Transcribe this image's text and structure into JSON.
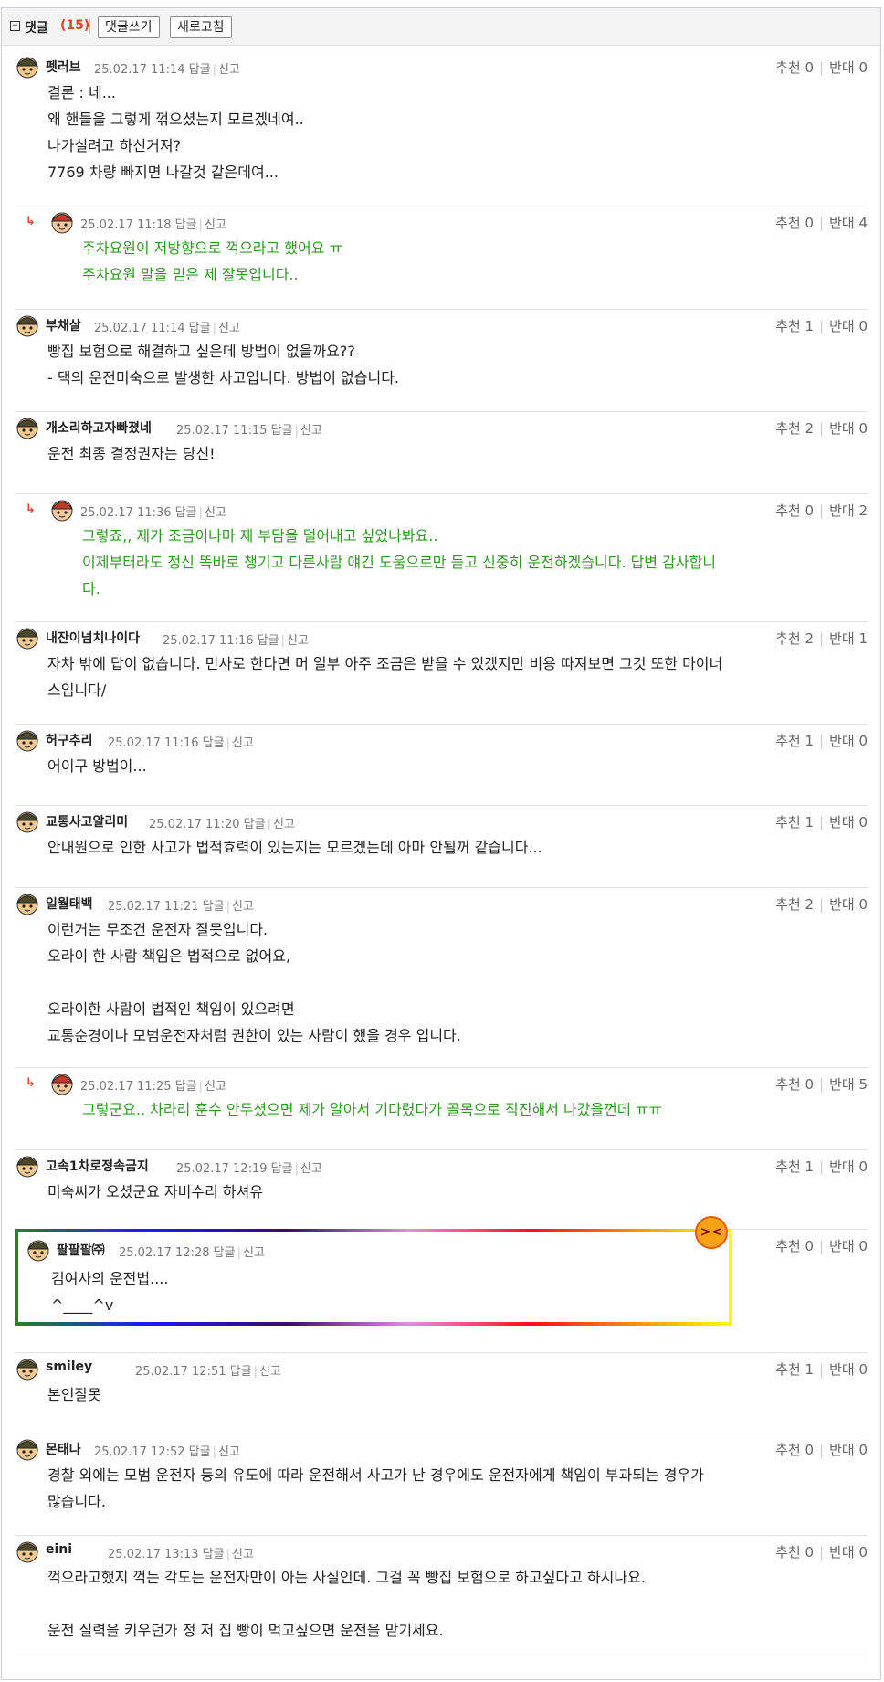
{
  "header": {
    "toggle_icon": "minus-box-icon",
    "title": "댓글",
    "count": "(15)",
    "write_button": "댓글쓰기",
    "refresh_button": "새로고침"
  },
  "labels": {
    "reply": "답글",
    "report": "신고",
    "up": "추천",
    "down": "반대"
  },
  "comments": [
    {
      "nick": "펫러브",
      "date": "25.02.17 11:14",
      "up": "0",
      "down": "0",
      "lines": "결론 : 네...\n왜 핸들을 그렇게 꺾으셨는지 모르겠네여..\n나가실려고 하신거져?\n7769 차량 빠지면 나갈것 같은데여..."
    },
    {
      "nick": "",
      "date": "25.02.17 11:18",
      "up": "0",
      "down": "4",
      "lines": "주차요원이 저방향으로 꺽으라고 했어요 ㅠ\n주차요원 말을 믿은 제 잘못입니다..",
      "reply": true
    },
    {
      "nick": "부채살",
      "date": "25.02.17 11:14",
      "up": "1",
      "down": "0",
      "lines": "빵집 보험으로 해결하고 싶은데 방법이 없을까요??\n- 댁의 운전미숙으로 발생한 사고입니다. 방법이 없습니다."
    },
    {
      "nick": "개소리하고자빠졌네",
      "date": "25.02.17 11:15",
      "up": "2",
      "down": "0",
      "lines": "운전 최종 결정권자는 당신!"
    },
    {
      "nick": "",
      "date": "25.02.17 11:36",
      "up": "0",
      "down": "2",
      "lines": "그렇죠,, 제가 조금이나마 제 부담을 덜어내고 싶었나봐요..\n이제부터라도 정신 똑바로 챙기고 다른사람 얘긴 도움으로만 듣고 신중히 운전하겠습니다. 답변 감사합니\n다.",
      "reply": true
    },
    {
      "nick": "내잔이넘치나이다",
      "date": "25.02.17 11:16",
      "up": "2",
      "down": "1",
      "lines": "자차 밖에 답이 없습니다. 민사로 한다면 머 일부 아주 조금은 받을 수 있겠지만 비용 따져보면 그것 또한 마이너\n스입니다/"
    },
    {
      "nick": "허구추리",
      "date": "25.02.17 11:16",
      "up": "1",
      "down": "0",
      "lines": "어이구 방법이..."
    },
    {
      "nick": "교통사고알리미",
      "date": "25.02.17 11:20",
      "up": "1",
      "down": "0",
      "lines": "안내원으로 인한 사고가 법적효력이 있는지는 모르겠는데 아마 안될꺼 같습니다..."
    },
    {
      "nick": "일월태백",
      "date": "25.02.17 11:21",
      "up": "2",
      "down": "0",
      "lines": "이런거는 무조건 운전자 잘못입니다.\n오라이 한 사람 책임은 법적으로 없어요,\n\n오라이한 사람이 법적인 책임이 있으려면\n교통순경이나 모범운전자처럼 권한이 있는 사람이 했을 경우 입니다."
    },
    {
      "nick": "",
      "date": "25.02.17 11:25",
      "up": "0",
      "down": "5",
      "lines": "그렇군요.. 차라리 훈수 안두셨으면 제가 알아서 기다렸다가 골목으로 직진해서 나갔을껀데 ㅠㅠ",
      "reply": true
    },
    {
      "nick": "고속1차로정속금지",
      "date": "25.02.17 12:19",
      "up": "1",
      "down": "0",
      "lines": "미숙씨가 오셨군요 자비수리 하셔유"
    },
    {
      "nick": "팔팔팔㈜",
      "date": "25.02.17 12:28",
      "up": "0",
      "down": "0",
      "lines": "김여사의 운전법....\n^____^v",
      "best": true
    },
    {
      "nick": "smiley",
      "date": "25.02.17 12:51",
      "up": "1",
      "down": "0",
      "lines": "본인잘못"
    },
    {
      "nick": "몬태나",
      "date": "25.02.17 12:52",
      "up": "0",
      "down": "0",
      "lines": "경찰 외에는 모범 운전자 등의 유도에 따라 운전해서 사고가 난 경우에도 운전자에게 책임이 부과되는 경우가\n많습니다."
    },
    {
      "nick": "eini",
      "date": "25.02.17 13:13",
      "up": "0",
      "down": "0",
      "lines": "꺽으라고했지 꺽는 각도는 운전자만이 아는 사실인데. 그걸 꼭 빵집 보험으로 하고싶다고 하시나요.\n\n운전 실력을 키우던가 정 저 집 빵이 먹고싶으면 운전을 맡기세요."
    }
  ],
  "colors": {
    "accent_red": "#e0452b",
    "reply_green": "#2f9a21",
    "meta_gray": "#777777"
  }
}
